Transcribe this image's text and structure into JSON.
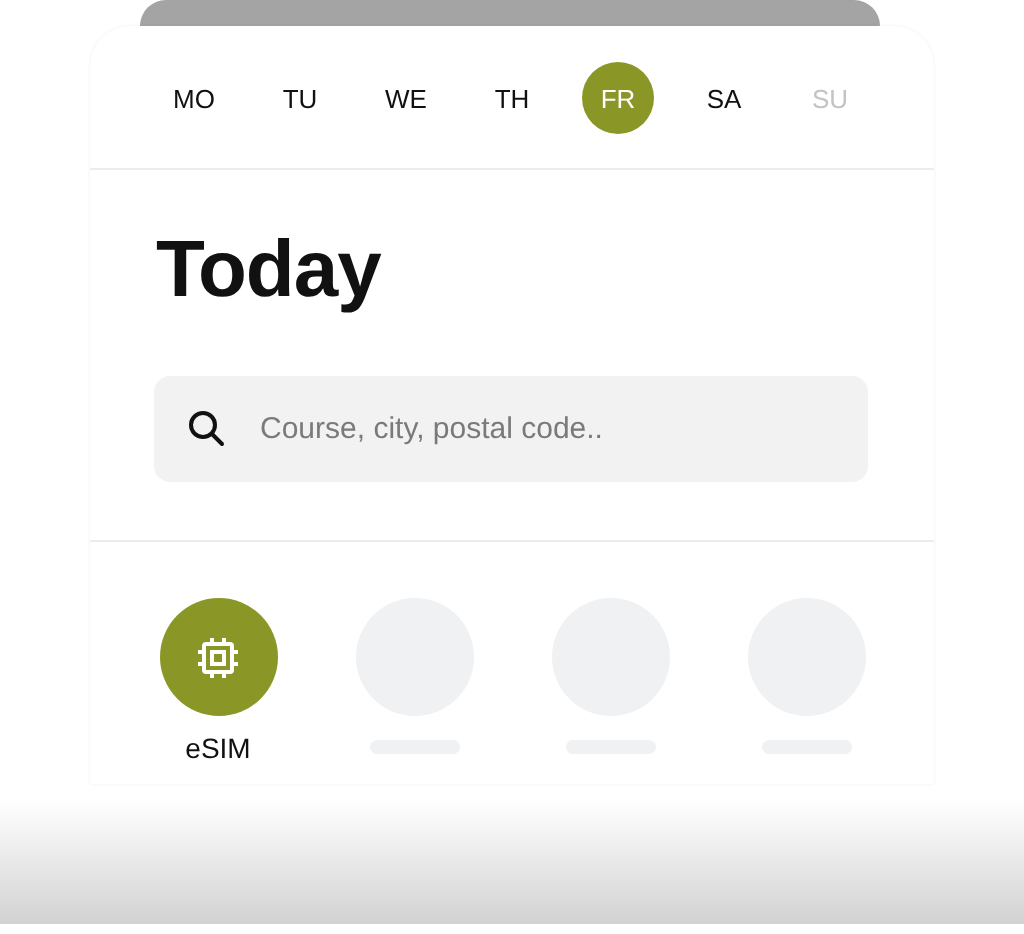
{
  "days": [
    {
      "label": "MO",
      "selected": false,
      "disabled": false
    },
    {
      "label": "TU",
      "selected": false,
      "disabled": false
    },
    {
      "label": "WE",
      "selected": false,
      "disabled": false
    },
    {
      "label": "TH",
      "selected": false,
      "disabled": false
    },
    {
      "label": "FR",
      "selected": true,
      "disabled": false
    },
    {
      "label": "SA",
      "selected": false,
      "disabled": false
    },
    {
      "label": "SU",
      "selected": false,
      "disabled": true
    }
  ],
  "title": "Today",
  "search": {
    "placeholder": "Course, city, postal code.."
  },
  "shortcuts": [
    {
      "kind": "esim",
      "label": "eSIM"
    },
    {
      "kind": "placeholder"
    },
    {
      "kind": "placeholder"
    },
    {
      "kind": "placeholder"
    }
  ]
}
